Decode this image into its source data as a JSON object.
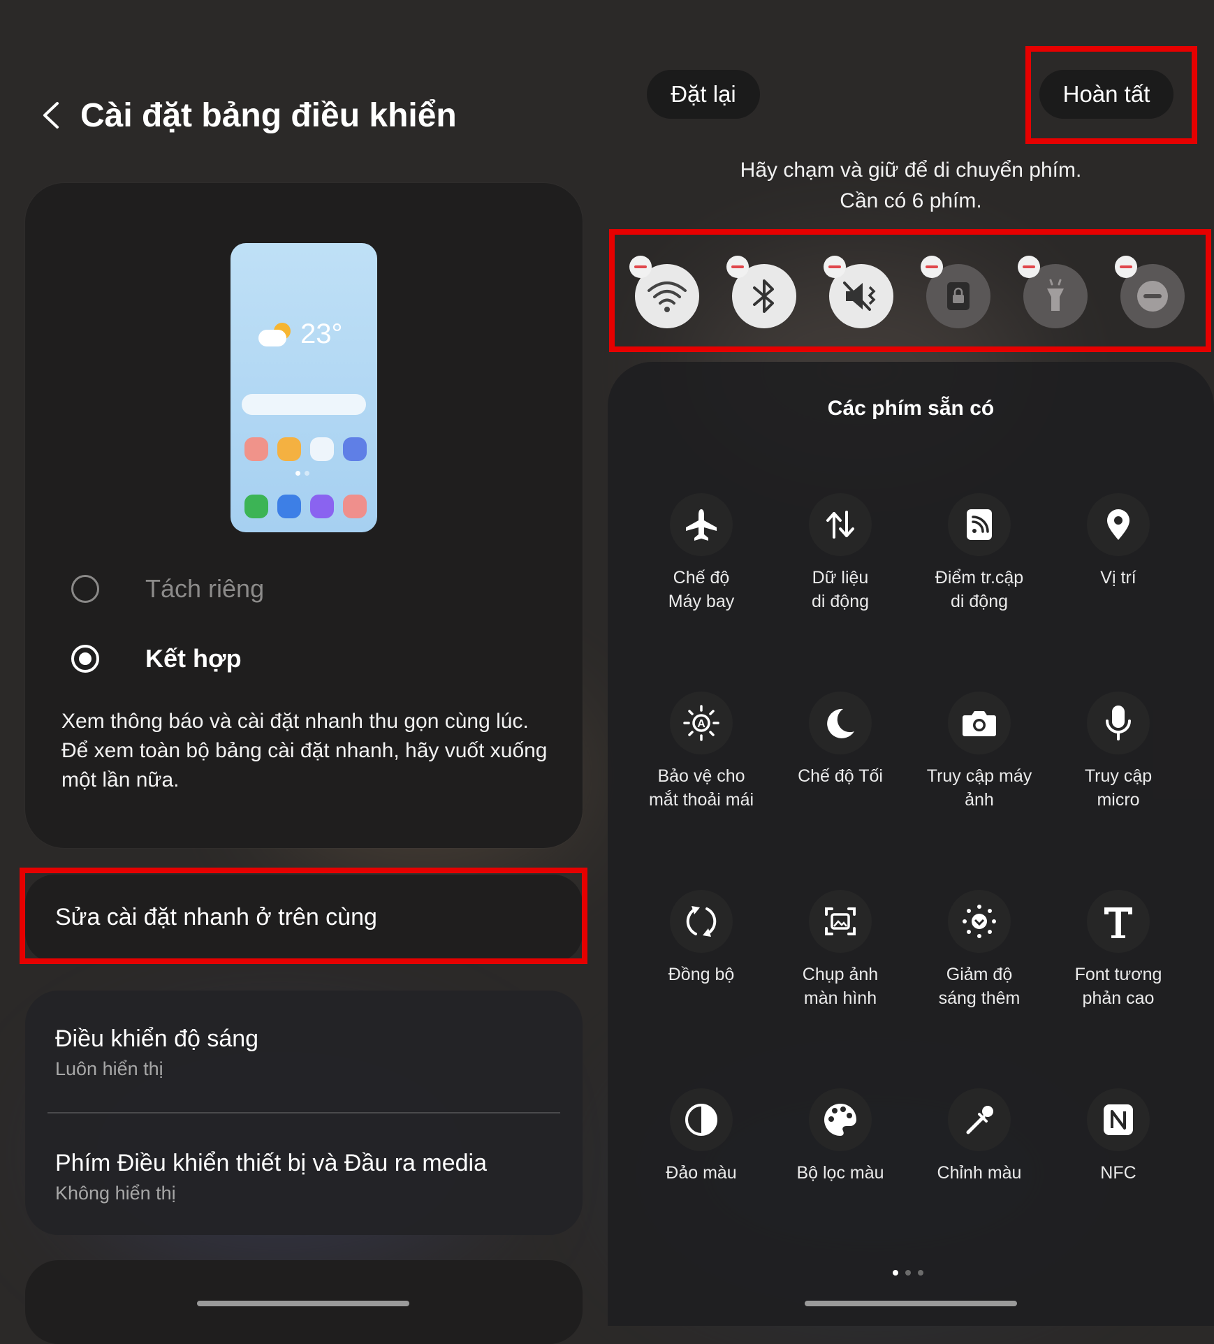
{
  "left": {
    "title": "Cài đặt bảng điều khiển",
    "preview": {
      "temperature": "23°"
    },
    "options": [
      {
        "label": "Tách riêng",
        "selected": false
      },
      {
        "label": "Kết hợp",
        "selected": true
      }
    ],
    "description": "Xem thông báo và cài đặt nhanh thu gọn cùng lúc. Để xem toàn bộ bảng cài đặt nhanh, hãy vuốt xuống một lần nữa.",
    "edit_label": "Sửa cài đặt nhanh ở trên cùng",
    "settings": [
      {
        "title": "Điều khiển độ sáng",
        "subtitle": "Luôn hiển thị"
      },
      {
        "title": "Phím Điều khiển thiết bị và Đầu ra media",
        "subtitle": "Không hiển thị"
      }
    ]
  },
  "right": {
    "reset_label": "Đặt lại",
    "done_label": "Hoàn tất",
    "hint_line1": "Hãy chạm và giữ để di chuyển phím.",
    "hint_line2": "Cần có 6 phím.",
    "active_tiles": [
      {
        "icon": "wifi-icon",
        "state": "on"
      },
      {
        "icon": "bluetooth-icon",
        "state": "on"
      },
      {
        "icon": "mute-vibrate-icon",
        "state": "on"
      },
      {
        "icon": "rotation-lock-icon",
        "state": "off"
      },
      {
        "icon": "flashlight-icon",
        "state": "off"
      },
      {
        "icon": "do-not-disturb-icon",
        "state": "off"
      }
    ],
    "available_title": "Các phím sẵn có",
    "available_tiles": [
      {
        "icon": "airplane-icon",
        "label": "Chế độ\nMáy bay"
      },
      {
        "icon": "mobile-data-icon",
        "label": "Dữ liệu\ndi động"
      },
      {
        "icon": "hotspot-icon",
        "label": "Điểm tr.cập\ndi động"
      },
      {
        "icon": "location-icon",
        "label": "Vị trí"
      },
      {
        "icon": "eye-comfort-icon",
        "label": "Bảo vệ cho\nmắt thoải mái"
      },
      {
        "icon": "dark-mode-icon",
        "label": "Chế độ Tối"
      },
      {
        "icon": "camera-access-icon",
        "label": "Truy cập máy\nảnh"
      },
      {
        "icon": "microphone-icon",
        "label": "Truy cập\nmicro"
      },
      {
        "icon": "sync-icon",
        "label": "Đồng bộ"
      },
      {
        "icon": "screenshot-icon",
        "label": "Chụp ảnh\nmàn hình"
      },
      {
        "icon": "extra-dim-icon",
        "label": "Giảm độ\nsáng thêm"
      },
      {
        "icon": "high-contrast-font-icon",
        "label": "Font tương\nphản cao"
      },
      {
        "icon": "color-inversion-icon",
        "label": "Đảo màu"
      },
      {
        "icon": "color-filter-icon",
        "label": "Bộ lọc màu"
      },
      {
        "icon": "color-correction-icon",
        "label": "Chỉnh màu"
      },
      {
        "icon": "nfc-icon",
        "label": "NFC"
      }
    ]
  },
  "colors": {
    "highlight": "#e60000",
    "minus": "#e0474c"
  }
}
